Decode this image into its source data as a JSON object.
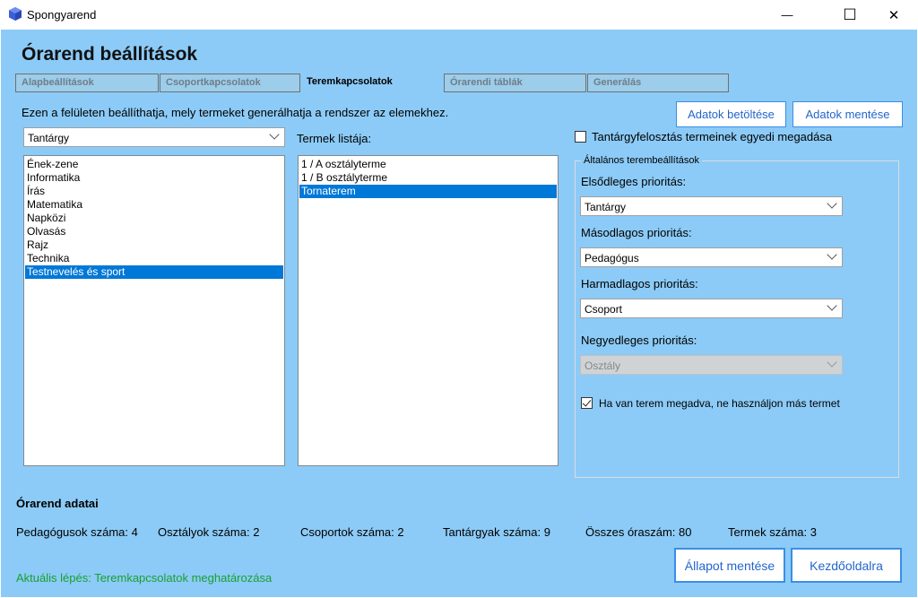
{
  "window": {
    "title": "Spongyarend",
    "minimize": "—",
    "maximize": "☐",
    "close": "✕"
  },
  "heading": "Órarend beállítások",
  "tabs": [
    {
      "label": "Alapbeállítások"
    },
    {
      "label": "Csoportkapcsolatok"
    },
    {
      "label": "Teremkapcsolatok"
    },
    {
      "label": "Órarendi táblák"
    },
    {
      "label": "Generálás"
    }
  ],
  "description": "Ezen a felületen beállíthatja, mely termeket generálhatja a rendszer az elemekhez.",
  "buttons": {
    "load": "Adatok betöltése",
    "save": "Adatok mentése",
    "save_state": "Állapot mentése",
    "home": "Kezdőoldalra"
  },
  "element_type_select": "Tantárgy",
  "subjects": [
    "Ének-zene",
    "Informatika",
    "Írás",
    "Matematika",
    "Napközi",
    "Olvasás",
    "Rajz",
    "Technika",
    "Testnevelés és sport"
  ],
  "rooms_label": "Termek listája:",
  "rooms": [
    "1 / A osztályterme",
    "1 / B osztályterme",
    "Tornaterem"
  ],
  "custom_rooms_checkbox": "Tantárgyfelosztás termeinek egyedi megadása",
  "general_settings": {
    "title": "Általános terembeállítások",
    "primary_label": "Elsődleges prioritás:",
    "primary_value": "Tantárgy",
    "secondary_label": "Másodlagos prioritás:",
    "secondary_value": "Pedagógus",
    "tertiary_label": "Harmadlagos prioritás:",
    "tertiary_value": "Csoport",
    "quaternary_label": "Negyedleges prioritás:",
    "quaternary_value": "Osztály",
    "no_other_room_checkbox": "Ha van terem megadva, ne használjon más termet"
  },
  "stats": {
    "title": "Órarend adatai",
    "teachers": "Pedagógusok száma: 4",
    "classes": "Osztályok száma: 2",
    "groups": "Csoportok száma: 2",
    "subjects": "Tantárgyak száma: 9",
    "total_hours": "Összes óraszám: 80",
    "rooms": "Termek száma: 3"
  },
  "status": "Aktuális lépés: Teremkapcsolatok meghatározása"
}
